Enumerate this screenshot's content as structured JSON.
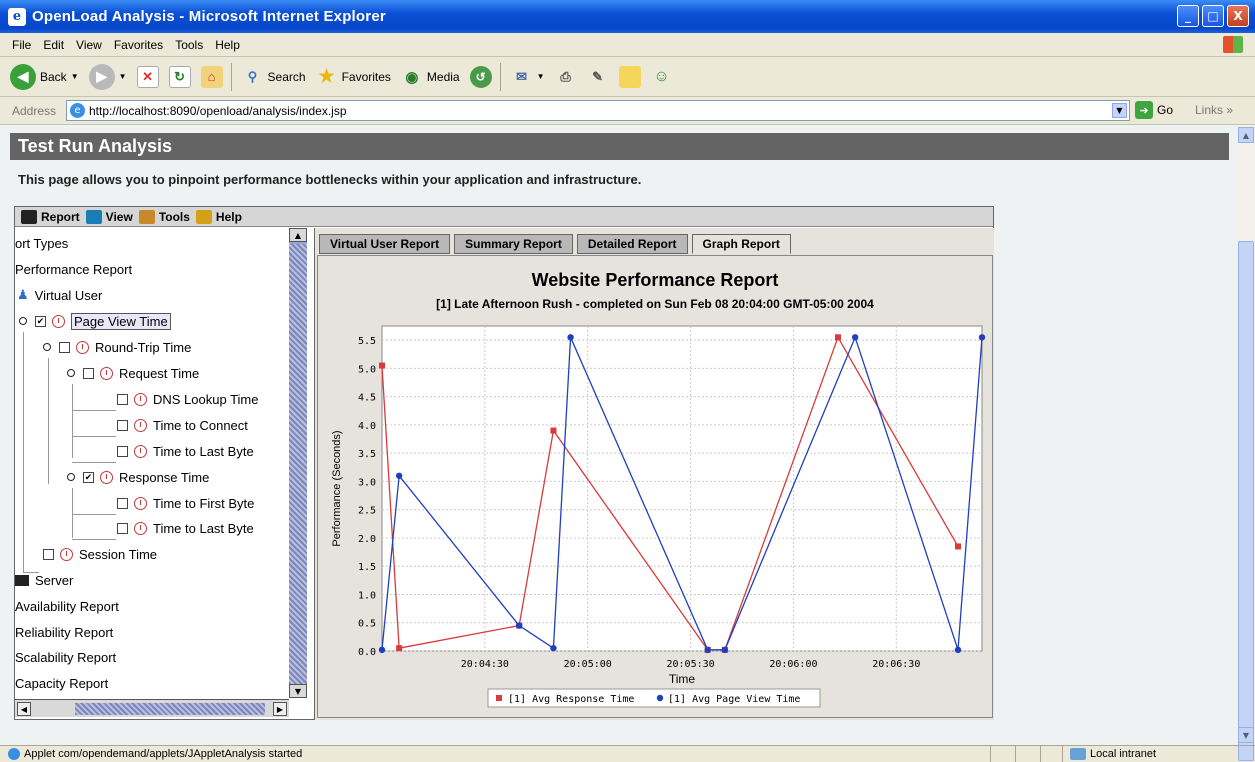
{
  "window": {
    "title": "OpenLoad Analysis - Microsoft Internet Explorer",
    "min": "_",
    "max": "□",
    "close": "X"
  },
  "menu": [
    "File",
    "Edit",
    "View",
    "Favorites",
    "Tools",
    "Help"
  ],
  "toolbar": {
    "back": "Back",
    "search": "Search",
    "favorites": "Favorites",
    "media": "Media"
  },
  "address": {
    "label": "Address",
    "url": "http://localhost:8090/openload/analysis/index.jsp",
    "go": "Go",
    "links": "Links"
  },
  "page": {
    "header": "Test Run Analysis",
    "intro": "This page allows you to pinpoint performance bottlenecks within your application and infrastructure."
  },
  "applet_menu": [
    "Report",
    "View",
    "Tools",
    "Help"
  ],
  "tree": [
    "ort Types",
    "Performance Report",
    "Virtual User",
    "Page View Time",
    "Round-Trip Time",
    "Request Time",
    "DNS Lookup Time",
    "Time to Connect",
    "Time to Last Byte",
    "Response Time",
    "Time to First Byte",
    "Time to Last Byte",
    "Session Time",
    "Server",
    "Availability Report",
    "Reliability Report",
    "Scalability Report",
    "Capacity Report"
  ],
  "tabs": [
    "Virtual User Report",
    "Summary Report",
    "Detailed Report",
    "Graph Report"
  ],
  "status": {
    "text": "Applet com/opendemand/applets/JAppletAnalysis started",
    "zone": "Local intranet"
  },
  "colors": {
    "response": "#d93a3a",
    "pageview": "#1f3fbf"
  },
  "chart_data": {
    "type": "line",
    "title": "Website Performance Report",
    "subtitle": "[1] Late Afternoon Rush - completed on Sun Feb 08 20:04:00 GMT-05:00 2004",
    "xlabel": "Time",
    "ylabel": "Performance (Seconds)",
    "xlim": [
      "20:04:00",
      "20:06:55"
    ],
    "ylim": [
      0,
      5.75
    ],
    "x_ticks": [
      "20:04:30",
      "20:05:00",
      "20:05:30",
      "20:06:00",
      "20:06:30"
    ],
    "y_ticks": [
      "0.0",
      "0.5",
      "1.0",
      "1.5",
      "2.0",
      "2.5",
      "3.0",
      "3.5",
      "4.0",
      "4.5",
      "5.0",
      "5.5"
    ],
    "grid": true,
    "legend_position": "bottom",
    "series": [
      {
        "name": "[1] Avg Response Time",
        "points": [
          [
            "20:04:00",
            5.05
          ],
          [
            "20:04:05",
            0.05
          ],
          [
            "20:04:40",
            0.45
          ],
          [
            "20:04:50",
            3.9
          ],
          [
            "20:05:35",
            0.02
          ],
          [
            "20:05:40",
            0.02
          ],
          [
            "20:06:13",
            5.55
          ],
          [
            "20:06:48",
            1.85
          ]
        ]
      },
      {
        "name": "[1] Avg Page View Time",
        "points": [
          [
            "20:04:00",
            0.02
          ],
          [
            "20:04:05",
            3.1
          ],
          [
            "20:04:40",
            0.45
          ],
          [
            "20:04:50",
            0.05
          ],
          [
            "20:04:55",
            5.55
          ],
          [
            "20:05:35",
            0.02
          ],
          [
            "20:05:40",
            0.02
          ],
          [
            "20:06:18",
            5.55
          ],
          [
            "20:06:48",
            0.02
          ],
          [
            "20:06:55",
            5.55
          ]
        ]
      }
    ]
  }
}
